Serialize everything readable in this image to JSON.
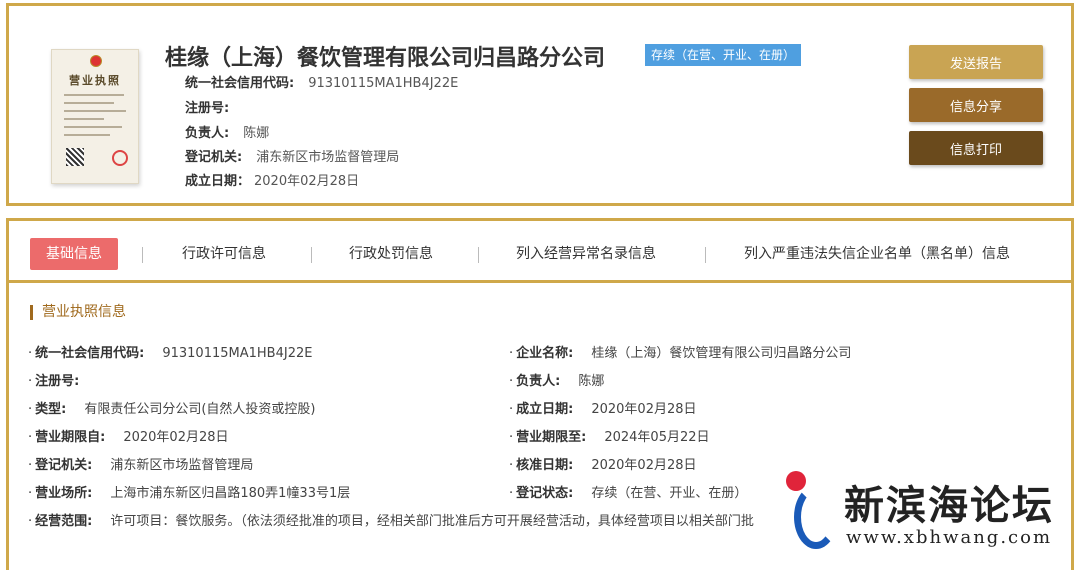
{
  "header": {
    "company_name": "桂缘（上海）餐饮管理有限公司归昌路分公司",
    "status": "存续（在营、开业、在册）",
    "license_title": "营业执照",
    "rows": [
      {
        "label": "统一社会信用代码:",
        "value": "91310115MA1HB4J22E"
      },
      {
        "label": "注册号:",
        "value": ""
      },
      {
        "label": "负责人:",
        "value": "陈娜"
      },
      {
        "label": "登记机关:",
        "value": "浦东新区市场监督管理局"
      },
      {
        "label": "成立日期：",
        "value": "2020年02月28日"
      }
    ],
    "buttons": {
      "report": "发送报告",
      "share": "信息分享",
      "print": "信息打印"
    }
  },
  "tabs": [
    "基础信息",
    "行政许可信息",
    "行政处罚信息",
    "列入经营异常名录信息",
    "列入严重违法失信企业名单（黑名单）信息"
  ],
  "section": {
    "title": "营业执照信息",
    "left": [
      {
        "label": "统一社会信用代码:",
        "value": "91310115MA1HB4J22E"
      },
      {
        "label": "注册号:",
        "value": ""
      },
      {
        "label": "类型:",
        "value": "有限责任公司分公司(自然人投资或控股)"
      },
      {
        "label": "营业期限自:",
        "value": "2020年02月28日"
      },
      {
        "label": "登记机关:",
        "value": "浦东新区市场监督管理局"
      },
      {
        "label": "营业场所:",
        "value": "上海市浦东新区归昌路180弄1幢33号1层"
      }
    ],
    "right": [
      {
        "label": "企业名称:",
        "value": "桂缘（上海）餐饮管理有限公司归昌路分公司"
      },
      {
        "label": "负责人:",
        "value": "陈娜"
      },
      {
        "label": "成立日期:",
        "value": "2020年02月28日"
      },
      {
        "label": "营业期限至:",
        "value": "2024年05月22日"
      },
      {
        "label": "核准日期:",
        "value": "2020年02月28日"
      },
      {
        "label": "登记状态:",
        "value": "存续（在营、开业、在册）"
      }
    ],
    "scope": {
      "label": "经营范围:",
      "value": "许可项目：餐饮服务。（依法须经批准的项目，经相关部门批准后方可开展经营活动，具体经营项目以相关部门批"
    }
  },
  "watermark": {
    "title": "新滨海论坛",
    "url": "www.xbhwang.com"
  },
  "colors": {
    "gold_border": "#cfa84a",
    "badge_blue": "#4f9fe0",
    "active_tab": "#ec6b6b",
    "btn_report": "#c9a453",
    "btn_share": "#9a6a2a",
    "btn_print": "#6a4a1c"
  }
}
